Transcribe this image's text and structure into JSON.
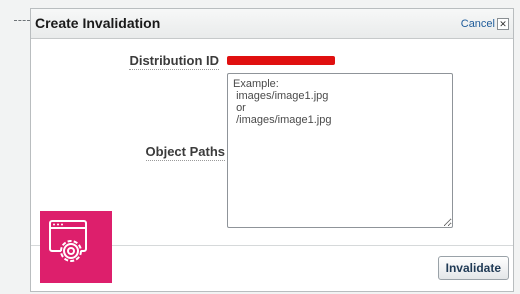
{
  "dialog": {
    "title": "Create Invalidation",
    "cancel_label": "Cancel",
    "cancel_icon": "close-icon"
  },
  "form": {
    "distribution_id_label": "Distribution ID",
    "object_paths_label": "Object Paths",
    "object_paths_placeholder": "Example:\n images/image1.jpg\n or\n /images/image1.jpg"
  },
  "footer": {
    "invalidate_label": "Invalidate"
  },
  "badge": {
    "icon": "settings-window-icon",
    "color": "#dd1f6c"
  }
}
